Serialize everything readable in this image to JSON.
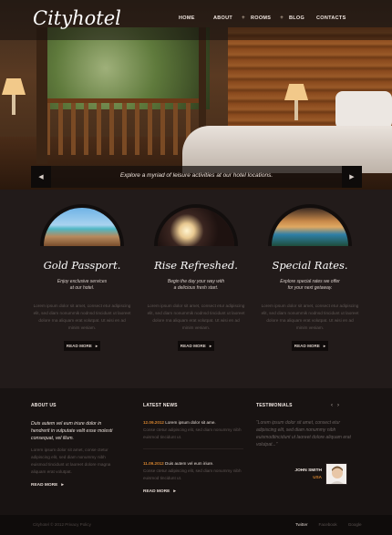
{
  "header": {
    "logo": "Cityhotel",
    "nav": [
      {
        "label": "HOME",
        "submenu": false
      },
      {
        "label": "ABOUT",
        "submenu": true
      },
      {
        "label": "ROOMS",
        "submenu": true
      },
      {
        "label": "BLOG",
        "submenu": false
      },
      {
        "label": "CONTACTS",
        "submenu": false
      }
    ],
    "submenu_marker": "+"
  },
  "slider": {
    "caption": "Explore a myriad of leisure activities at our hotel locations.",
    "prev_icon": "chevron-left-icon",
    "next_icon": "chevron-right-icon"
  },
  "features": [
    {
      "title": "Gold Passport.",
      "subtitle_1": "Enjoy exclusive services",
      "subtitle_2": "at our hotel.",
      "body": "Lorem ipsum dolor sit amet, consect etur adipiscing elit, sed diam nonummik nodnsd tincidunt ut laoreet dolore rna aliquam erat volutpat. Ut wisi en ad minim veniam.",
      "button": "READ MORE",
      "image": "beach-pool-image"
    },
    {
      "title": "Rise Refreshed.",
      "subtitle_1": "Begin the day your way with",
      "subtitle_2": "a delicious fresh start.",
      "body": "Lorem ipsum dolor sit amet, consect etur adipiscing elit, sed diam nonummik nodnsd tincidunt ut laoreet dolore rna aliquam erat volutpat. Ut wisi en ad minim veniam.",
      "button": "READ MORE",
      "image": "spa-candles-image"
    },
    {
      "title": "Special Rates.",
      "subtitle_1": "Explore special rates we offer",
      "subtitle_2": "for your next getaway.",
      "body": "Lorem ipsum dolor sit amet, consect etur adipiscing elit, sed diam nonummik nodnsd tincidunt ut laoreet dolore rna aliquam erat volutpat. Ut wisi en ad minim veniam.",
      "button": "READ MORE",
      "image": "resort-night-image"
    }
  ],
  "about": {
    "heading": "ABOUT US",
    "lead": "Duis autem vel eum iriure dolor in hendrerit in vulputate velit esse molesti consequat, vel illum.",
    "body": "Lorem ipsum dolor sit amet, conse ctetur adipiscing elit, sed diam nonummy nibh euismod tincidunt ut laoreet dolore magna aliquam erat volutpat.",
    "link": "READ MORE"
  },
  "news": {
    "heading": "LATEST NEWS",
    "items": [
      {
        "date": "12.09.2012",
        "headline": "Lorem ipsum dolor sit ame.",
        "body": "Conse ctetur adipiscing elit, sed diam nonummy nibh euismod tincidunt ut."
      },
      {
        "date": "11.09.2012",
        "headline": "Duis autem vel eum iriure.",
        "body": "Conse ctetur adipiscing elit, sed diam nonummy nibh euismod tincidunt ut."
      }
    ],
    "link": "READ MORE"
  },
  "testimonials": {
    "heading": "TESTIMONIALS",
    "quote": "“Lorem ipsum dolor sit amet, consect etur adipiscing elit, sed diam nonummy nibh euismodtincidunt ut laoreet dolore aliquam erat volutpat...”",
    "name": "JOHN SMITH",
    "location": "USA",
    "prev_icon": "chevron-left-icon",
    "next_icon": "chevron-right-icon"
  },
  "footer": {
    "copyright": "Cityhotel © 2012 Privacy Policy",
    "social": [
      "Twitter",
      "Facebook",
      "Google"
    ]
  },
  "colors": {
    "accent": "#d0812e",
    "background": "#1f1918",
    "panel_dark": "#181312"
  }
}
